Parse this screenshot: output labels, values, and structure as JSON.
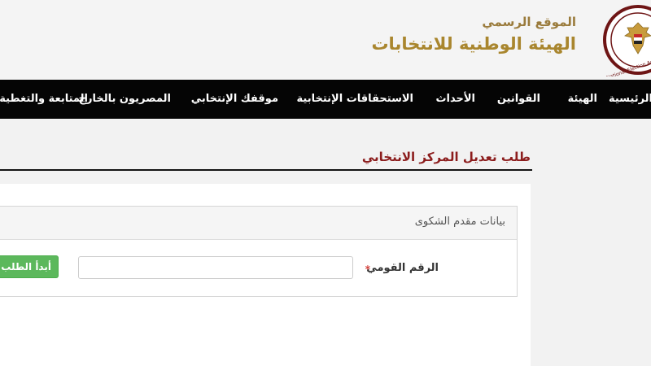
{
  "header": {
    "subtitle": "الموقع الرسمي",
    "title": "الهيئة الوطنية للانتخابات",
    "logo_text": "National Election Authority",
    "logo_icon": "egypt-eagle-emblem"
  },
  "nav": {
    "items": [
      {
        "label": "الرئيسية"
      },
      {
        "label": "الهيئة"
      },
      {
        "label": "القوانين"
      },
      {
        "label": "الأحداث"
      },
      {
        "label": "الاستحقاقات الإنتخابية"
      },
      {
        "label": "موقفك الإنتخابي"
      },
      {
        "label": "المصريون بالخارج"
      },
      {
        "label": "المتابعة والتغطية"
      }
    ]
  },
  "page": {
    "title": "طلب تعديل المركز الانتخابي"
  },
  "form": {
    "section_title": "بيانات مقدم الشكوى",
    "national_id_label": "الرقم القومي",
    "required_mark": "*",
    "national_id_value": "",
    "start_button": "أبدأ الطلب"
  },
  "colors": {
    "brand_gold": "#a9862e",
    "title_red": "#8c1d1d",
    "nav_bg": "#050505",
    "button_green": "#5cb85c"
  }
}
